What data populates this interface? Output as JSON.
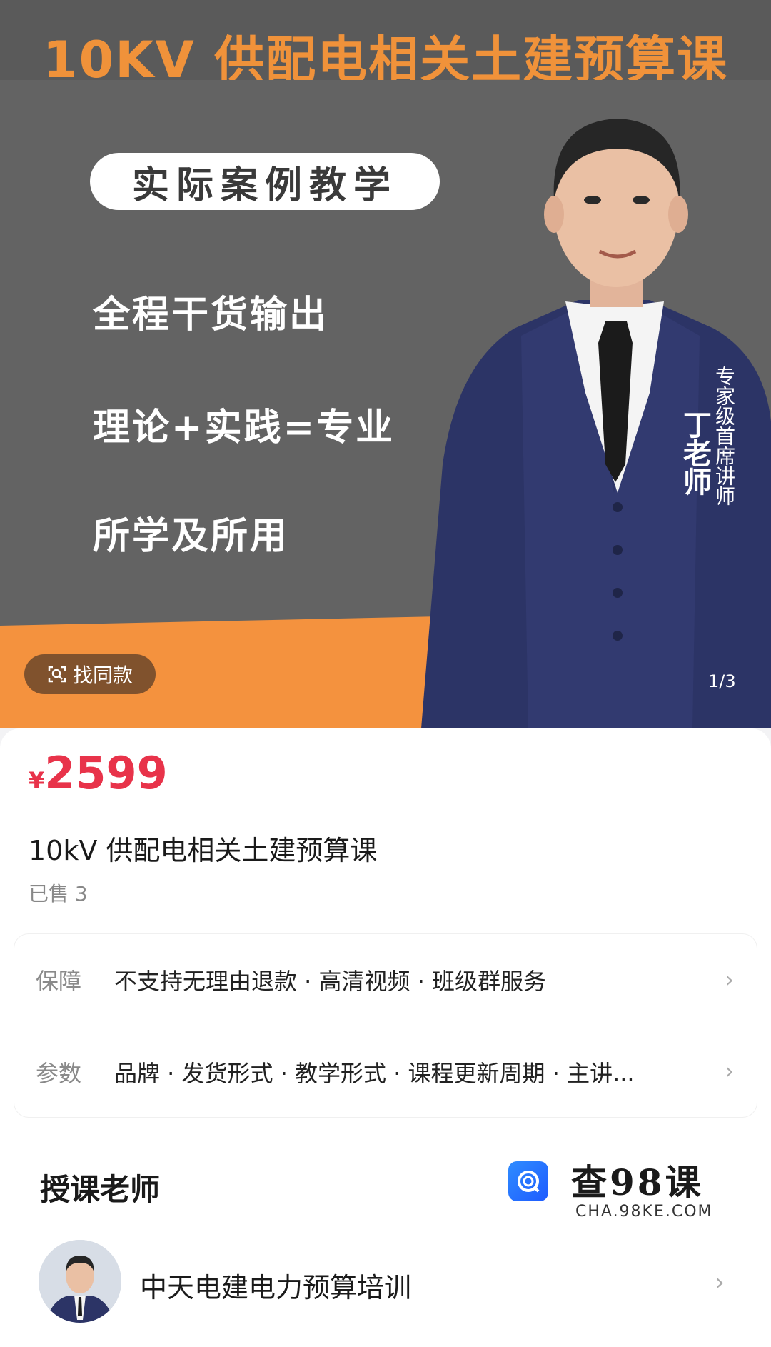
{
  "banner": {
    "title": "10KV 供配电相关土建预算课",
    "tag": "实际案例教学",
    "slogans": [
      "全程干货输出",
      "理论+实践=专业",
      "所学及所用"
    ],
    "teacher_name_vertical": "丁老师",
    "teacher_role_vertical": "专家级首席讲师",
    "find_same_label": "找同款",
    "pager": "1/3",
    "colors": {
      "orange": "#f4923e",
      "gray": "#636363"
    }
  },
  "product": {
    "price_symbol": "¥",
    "price": "2599",
    "title": "10kV 供配电相关土建预算课",
    "sold": "已售 3",
    "price_color": "#e8334a"
  },
  "attributes": [
    {
      "label": "保障",
      "value": "不支持无理由退款 · 高清视频 · 班级群服务"
    },
    {
      "label": "参数",
      "value": "品牌 · 发货形式 · 教学形式 · 课程更新周期 · 主讲..."
    }
  ],
  "teacher_section": {
    "heading": "授课老师",
    "name": "中天电建电力预算培训"
  },
  "watermark": {
    "text": "查98课",
    "sub": "CHA.98KE.COM"
  }
}
